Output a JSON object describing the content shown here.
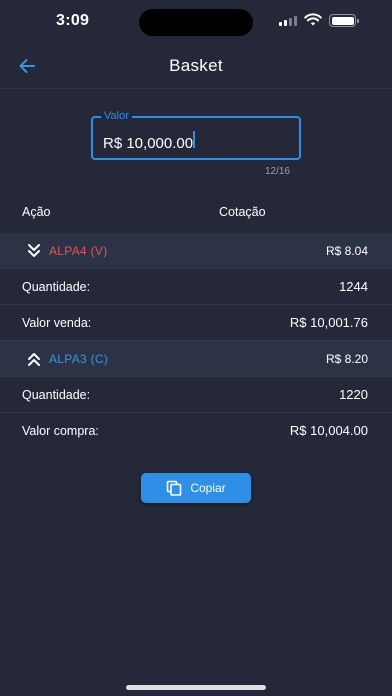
{
  "status_bar": {
    "time": "3:09"
  },
  "header": {
    "title": "Basket"
  },
  "valor_field": {
    "label": "Valor",
    "value": "R$ 10,000.00",
    "counter": "12/16"
  },
  "table": {
    "headers": {
      "acao": "Ação",
      "cotacao": "Cotação"
    },
    "sell": {
      "ticker": "ALPA4 (V)",
      "price": "R$ 8.04",
      "quantity_label": "Quantidade:",
      "quantity": "1244",
      "total_label": "Valor venda:",
      "total": "R$ 10,001.76"
    },
    "buy": {
      "ticker": "ALPA3 (C)",
      "price": "R$ 8.20",
      "quantity_label": "Quantidade:",
      "quantity": "1220",
      "total_label": "Valor compra:",
      "total": "R$ 10,004.00"
    }
  },
  "actions": {
    "copy_label": "Copiar"
  },
  "colors": {
    "background": "#242838",
    "accent": "#2f8fe6",
    "sell": "#e5574f",
    "buy": "#3a94e0",
    "highlight_row": "#2c3347"
  }
}
